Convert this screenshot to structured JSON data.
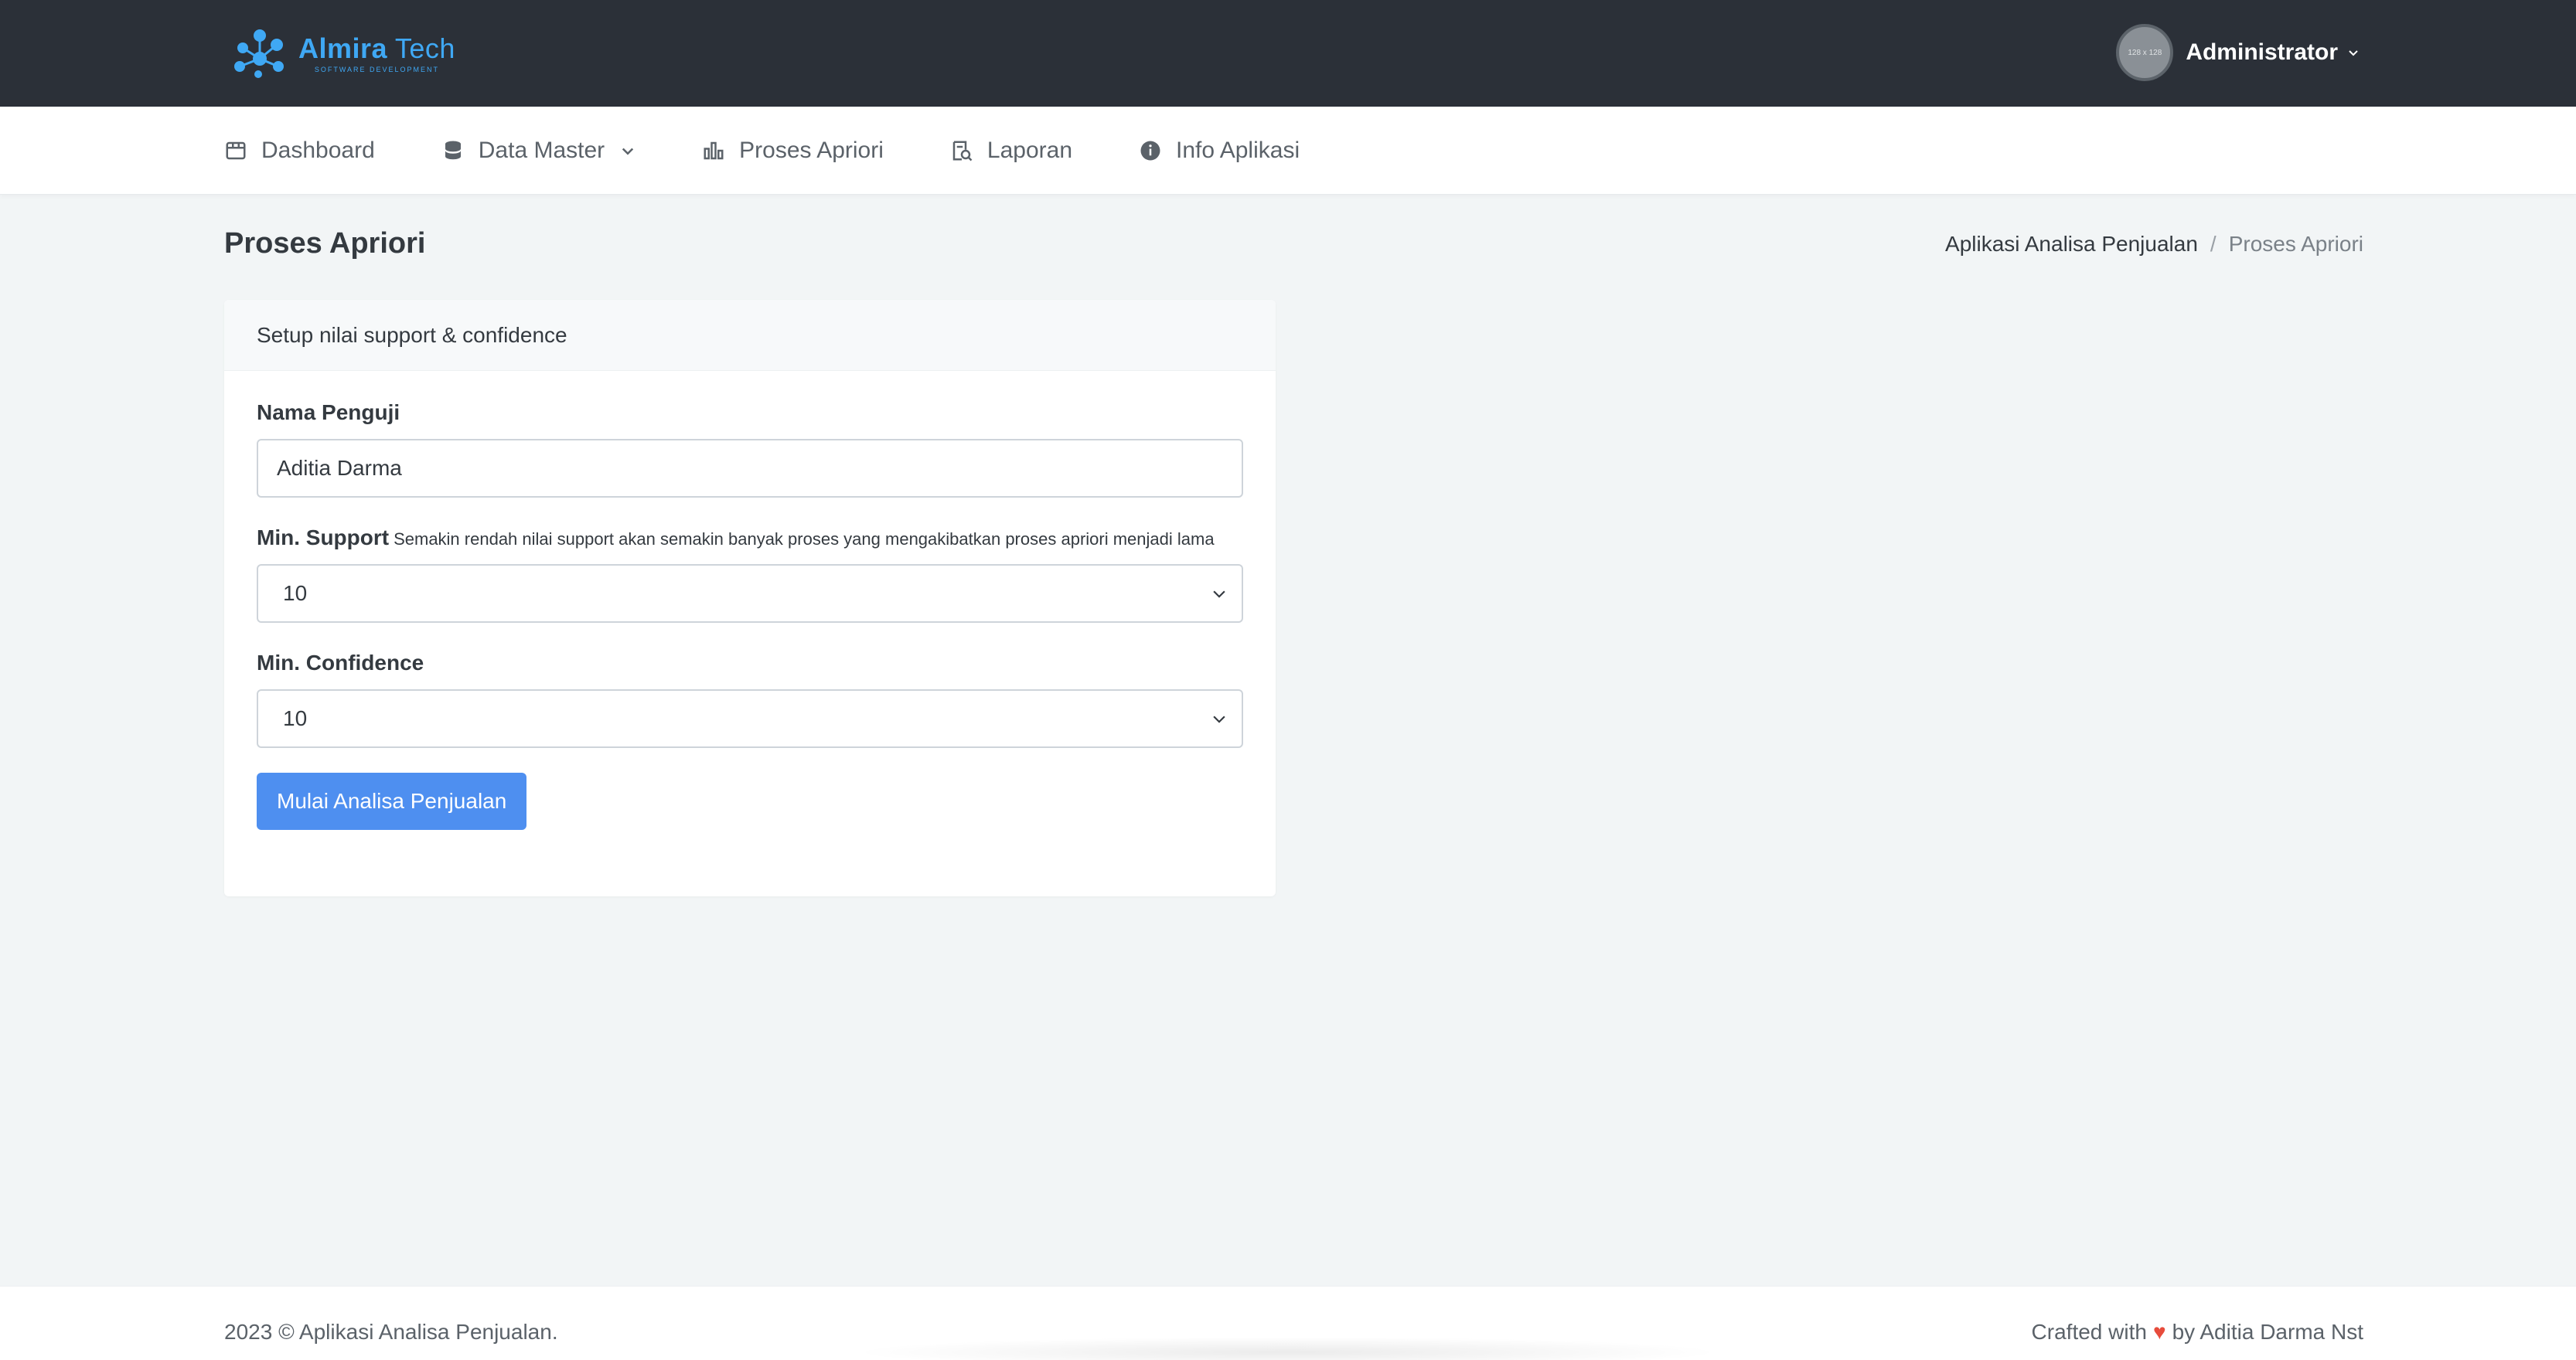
{
  "brand": {
    "title_bold": "Almira",
    "title_rest": " Tech",
    "subtitle": "SOFTWARE DEVELOPMENT",
    "color": "#3fa8f4"
  },
  "user": {
    "avatar_text": "128 x 128",
    "name": "Administrator",
    "icon": "chevron-down-icon"
  },
  "nav": {
    "items": [
      {
        "label": "Dashboard",
        "icon": "dashboard-icon"
      },
      {
        "label": "Data Master",
        "icon": "database-icon"
      },
      {
        "label": "Proses Apriori",
        "icon": "bar-chart-icon"
      },
      {
        "label": "Laporan",
        "icon": "report-search-icon"
      },
      {
        "label": "Info Aplikasi",
        "icon": "info-icon"
      }
    ]
  },
  "page": {
    "title": "Proses Apriori",
    "breadcrumb": [
      "Aplikasi Analisa Penjualan",
      "/",
      "Proses Apriori"
    ]
  },
  "form": {
    "header": "Setup nilai support & confidence",
    "tester_label": "Nama Penguji",
    "tester_value": "Aditia Darma",
    "support_label": "Min. Support",
    "support_hint": "Semakin rendah nilai support akan semakin banyak proses yang mengakibatkan proses apriori menjadi lama",
    "support_value": "10",
    "confidence_label": "Min. Confidence",
    "confidence_value": "10",
    "submit_label": "Mulai Analisa Penjualan",
    "accent": "#4e8ff0"
  },
  "footer": {
    "copyright": "2023 © Aplikasi Analisa Penjualan.",
    "crafted_prefix": "Crafted with",
    "heart": "♥",
    "crafted_suffix": "by Aditia Darma Nst",
    "heart_color": "#e74c3c"
  }
}
